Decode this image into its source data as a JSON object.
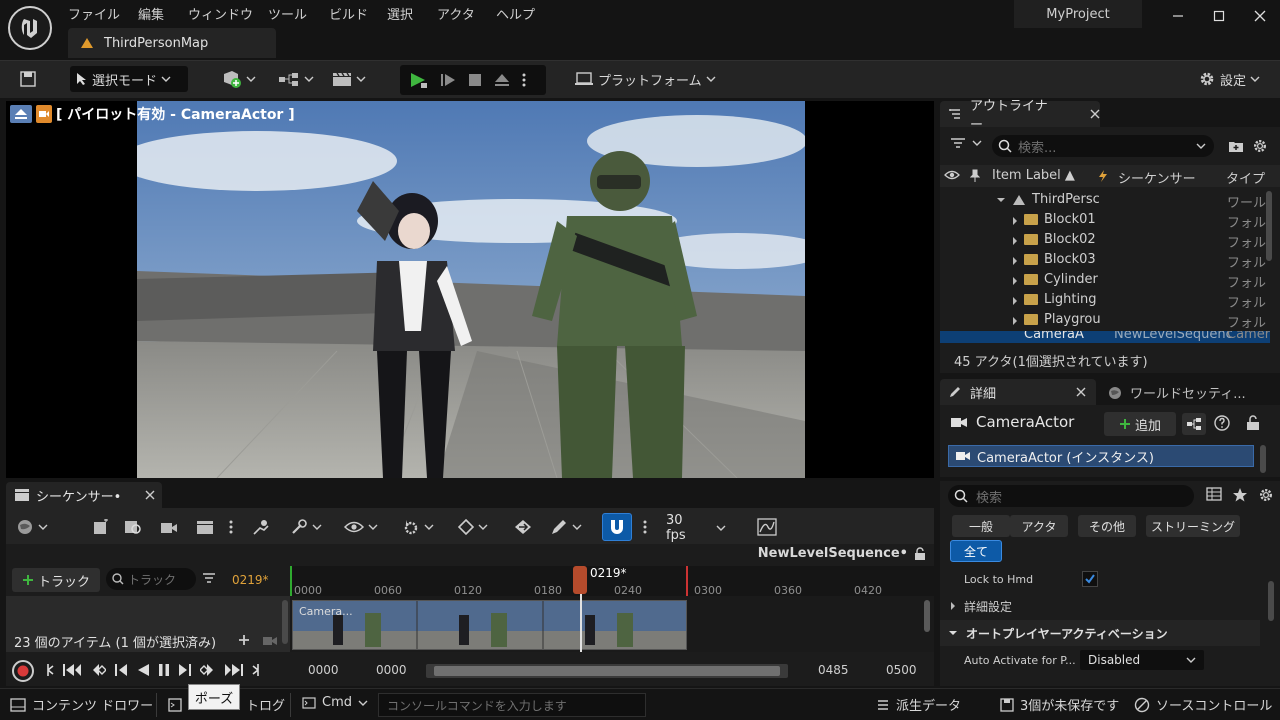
{
  "menu": [
    "ファイル",
    "編集",
    "ウィンドウ",
    "ツール",
    "ビルド",
    "選択",
    "アクタ",
    "ヘルプ"
  ],
  "project_name": "MyProject",
  "map_tab": "ThirdPersonMap",
  "toolbar": {
    "select_mode": "選択モード",
    "platform": "プラットフォーム",
    "settings": "設定"
  },
  "viewport": {
    "pilot_label": "[ パイロット有効 - CameraActor ]"
  },
  "sequencer": {
    "tab_label": "シーケンサー•",
    "fps": "30 fps",
    "sequence_name": "NewLevelSequence•",
    "add_track": "トラック",
    "track_search_placeholder": "トラック",
    "current_frame": "0219*",
    "playhead_label": "0219*",
    "ruler_ticks": [
      "0000",
      "0060",
      "0120",
      "0180",
      "0240",
      "0300",
      "0360",
      "0420"
    ],
    "clip_label": "Camera...",
    "item_count": "23 個のアイテム (1 個が選択済み)",
    "range_start": "0000",
    "range_start2": "0000",
    "range_end": "0485",
    "range_end2": "0500"
  },
  "outliner": {
    "tab_label": "アウトライナー",
    "search_placeholder": "検索...",
    "columns": {
      "label": "Item Label ▲",
      "sequencer": "シーケンサー",
      "type": "タイプ"
    },
    "rows": [
      {
        "name": "ThirdPersc",
        "type": "ワール",
        "kind": "world"
      },
      {
        "name": "Block01",
        "type": "フォル",
        "kind": "folder"
      },
      {
        "name": "Block02",
        "type": "フォル",
        "kind": "folder"
      },
      {
        "name": "Block03",
        "type": "フォル",
        "kind": "folder"
      },
      {
        "name": "Cylinder",
        "type": "フォル",
        "kind": "folder"
      },
      {
        "name": "Lighting",
        "type": "フォル",
        "kind": "folder"
      },
      {
        "name": "Playgrou",
        "type": "フォル",
        "kind": "folder"
      },
      {
        "name": "CameraA",
        "seq": "NewLevelSequenc",
        "type": "Camer",
        "kind": "camera"
      }
    ],
    "status": "45 アクタ(1個選択されています)"
  },
  "details": {
    "tab_label": "詳細",
    "world_settings_tab": "ワールドセッティ...",
    "actor_name": "CameraActor",
    "add_button": "追加",
    "component": "CameraActor (インスタンス)",
    "search_placeholder": "検索",
    "categories": [
      "一般",
      "アクタ",
      "その他",
      "ストリーミング",
      "全て"
    ],
    "lock_to_hmd": "Lock to Hmd",
    "advanced": "詳細設定",
    "section_auto_player": "オートプレイヤーアクティベーション",
    "auto_activate_label": "Auto Activate for P...",
    "auto_activate_value": "Disabled"
  },
  "statusbar": {
    "content_drawer": "コンテンツ ドロワー",
    "output_log": "トログ",
    "cmd": "Cmd",
    "console_placeholder": "コンソールコマンドを入力します",
    "derived_data": "派生データ",
    "unsaved": "3個が未保存です",
    "source_control": "ソースコントロール"
  },
  "tooltip": "ポーズ",
  "colors": {
    "accent": "#0d5aa7",
    "play_green": "#3fb63f",
    "playhead": "#b54b2c",
    "folder": "#c8a24a"
  }
}
